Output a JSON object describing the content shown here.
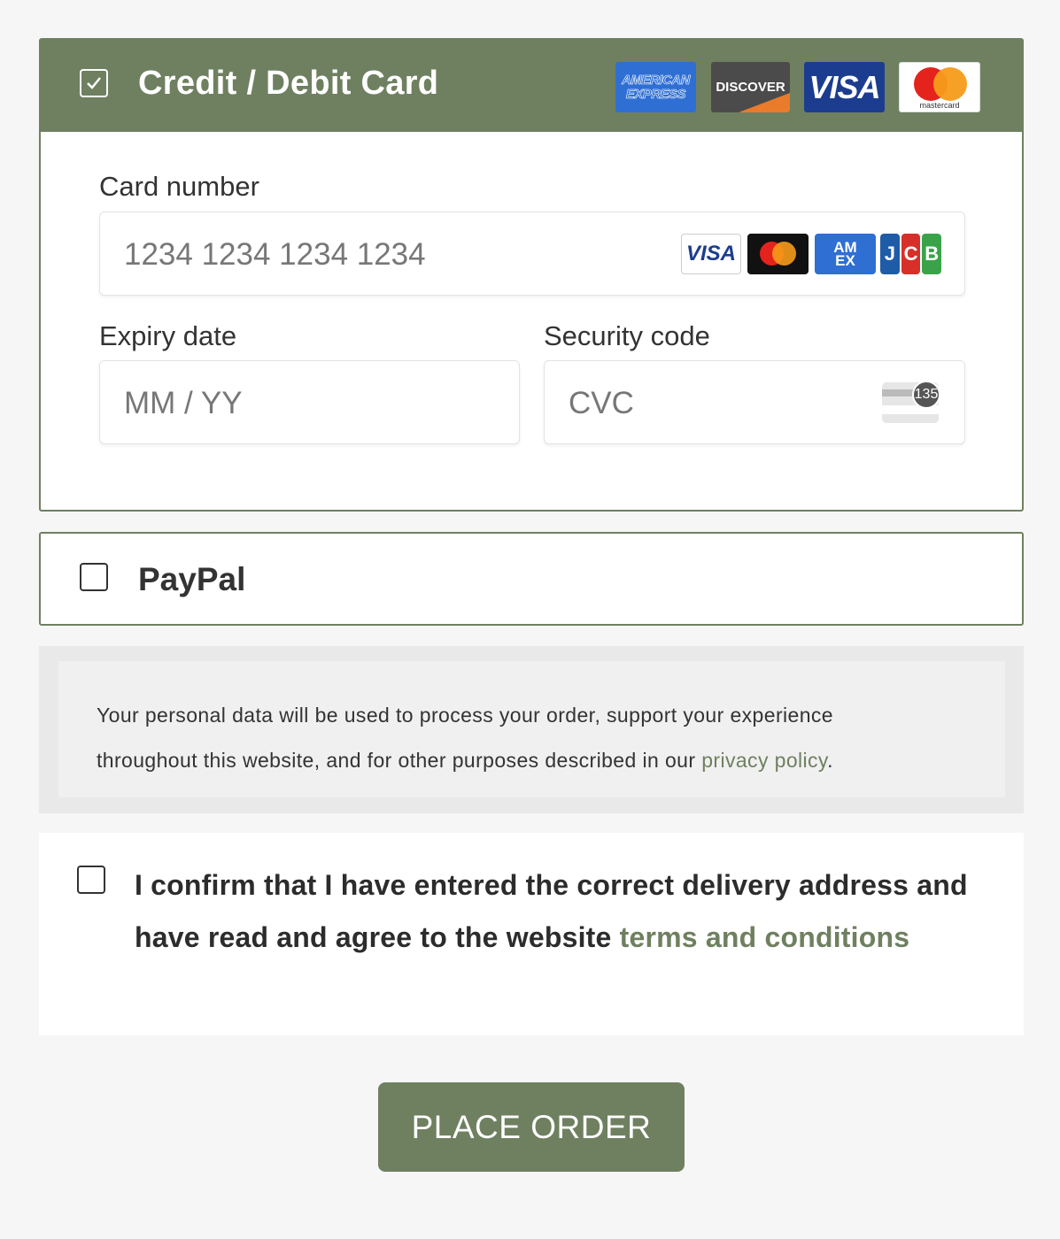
{
  "card_section": {
    "title": "Credit / Debit Card",
    "brands": {
      "amex_line1": "AMERICAN",
      "amex_line2": "EXPRESS",
      "discover": "DISCOVER",
      "visa": "VISA",
      "mastercard": "mastercard"
    },
    "card_number": {
      "label": "Card number",
      "placeholder": "1234 1234 1234 1234"
    },
    "card_icons": {
      "visa": "VISA",
      "amex_line1": "AM",
      "amex_line2": "EX",
      "jcb": [
        "J",
        "C",
        "B"
      ]
    },
    "expiry": {
      "label": "Expiry date",
      "placeholder": "MM / YY"
    },
    "security": {
      "label": "Security code",
      "placeholder": "CVC",
      "badge": "135"
    },
    "selected": true
  },
  "paypal_section": {
    "title": "PayPal",
    "selected": false
  },
  "privacy": {
    "text_line1": "Your personal data will be used to process your order, support your experience",
    "text_line2": "throughout this website, and for other purposes described in our ",
    "link": "privacy policy",
    "end": "."
  },
  "confirm": {
    "text": "I confirm that I have entered the correct delivery address and have read and agree to the website ",
    "link": "terms and conditions",
    "checked": false
  },
  "place_order": {
    "label": "PLACE ORDER"
  },
  "colors": {
    "accent": "#6f8060",
    "background": "#f6f6f6"
  }
}
